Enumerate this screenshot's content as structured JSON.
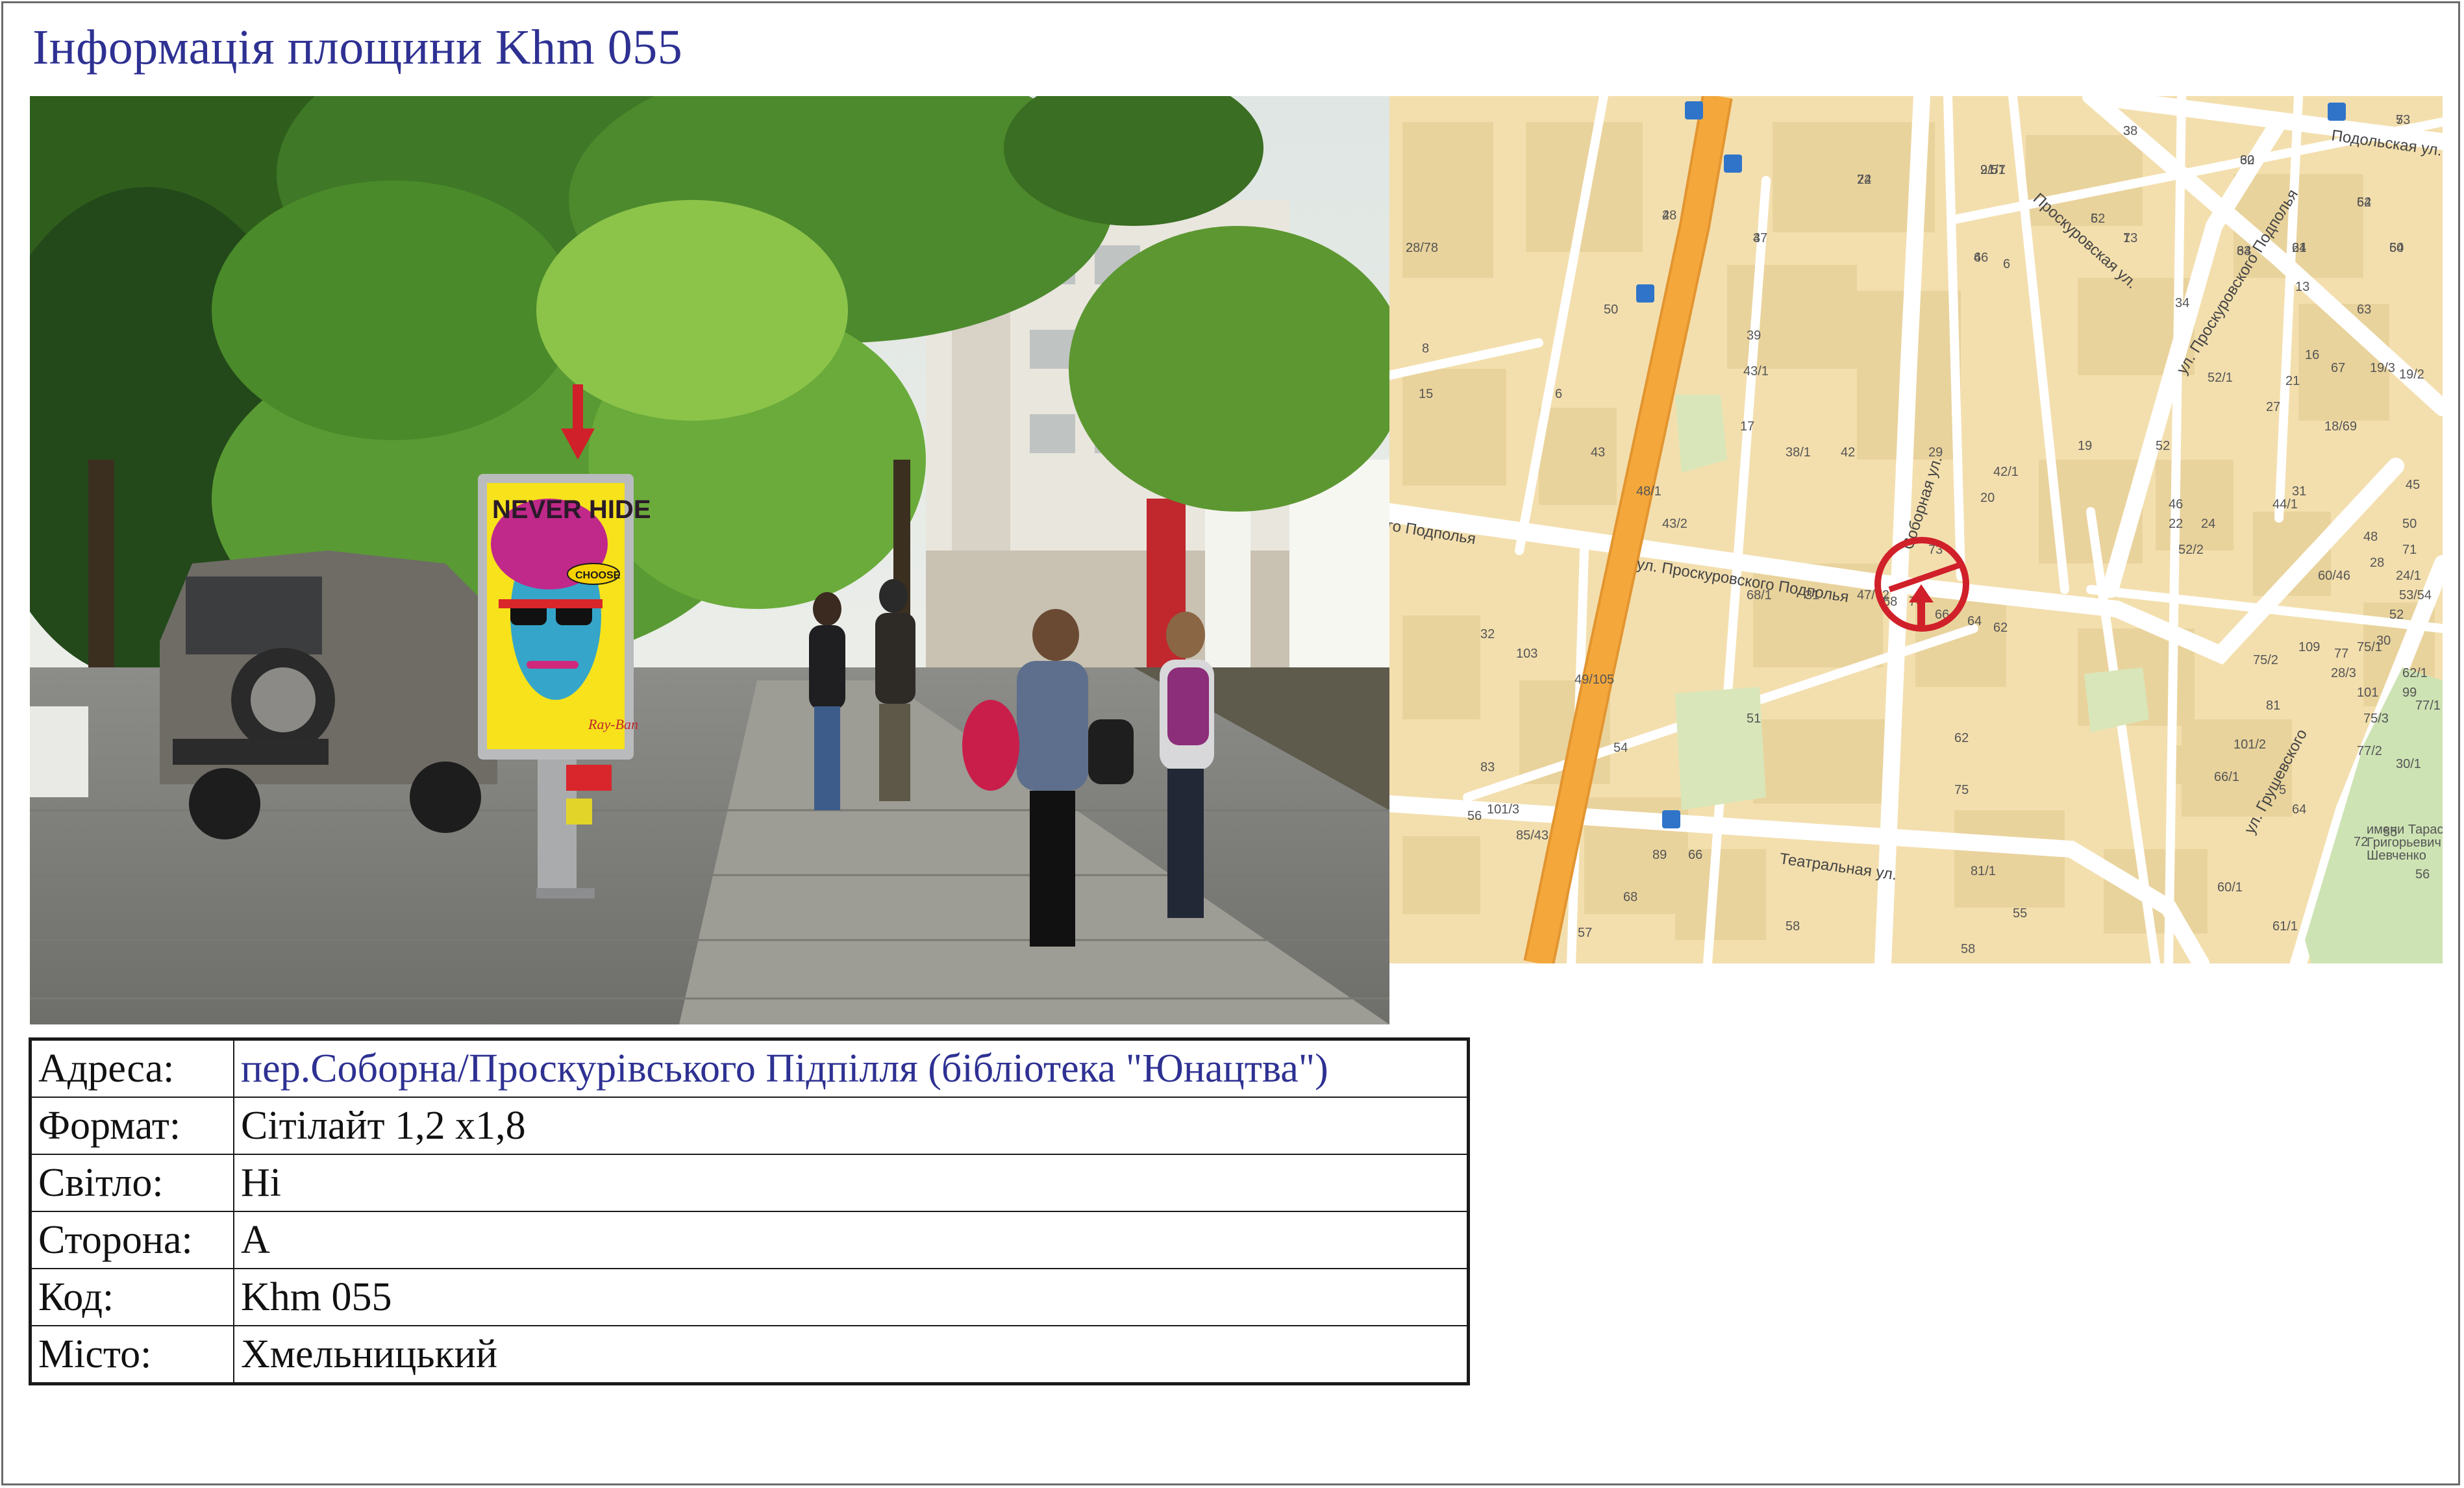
{
  "header": {
    "title": "Інформація площини Khm 055"
  },
  "photo": {
    "poster_text": "NEVER HIDE",
    "poster_badge": "CHOOSE",
    "poster_brand": "Ray-Ban"
  },
  "map": {
    "streets": [
      "ул. Проскуровского Подполья",
      "ского Подполья",
      "Соборная ул.",
      "Проскуровская ул.",
      "ул. Проскуровского Подполья",
      "Подольская ул.",
      "Театральная ул.",
      "ул. Грушевского"
    ],
    "park_label": [
      "имени Тараса",
      "Григорьевич",
      "Шевченко"
    ],
    "house_numbers": [
      "38",
      "73",
      "21/1",
      "32",
      "22",
      "48",
      "37",
      "5",
      "7",
      "34",
      "61",
      "52",
      "54",
      "2",
      "4",
      "6",
      "13",
      "50",
      "34",
      "63",
      "16",
      "39",
      "8",
      "43/1",
      "67",
      "19/3",
      "19/2",
      "21",
      "15",
      "6",
      "52/1",
      "27",
      "18/69",
      "17",
      "19",
      "43",
      "29",
      "52",
      "42",
      "38/1",
      "42/1",
      "48/1",
      "46",
      "31",
      "45",
      "43/2",
      "20",
      "22",
      "24",
      "52/2",
      "44/1",
      "50",
      "48",
      "71",
      "73",
      "28",
      "24/1",
      "68/1",
      "31",
      "47/72",
      "68",
      "70",
      "66",
      "64",
      "62",
      "60/46",
      "53/54",
      "52",
      "75",
      "30",
      "32",
      "109",
      "77",
      "75/1",
      "75/2",
      "28/3",
      "62/1",
      "103",
      "101",
      "99",
      "49/105",
      "81",
      "77/1",
      "75/3",
      "51",
      "62",
      "101/2",
      "77/2",
      "30/1",
      "5",
      "54",
      "83",
      "66/1",
      "64",
      "101/3",
      "56",
      "85/43",
      "81/1",
      "55",
      "66",
      "89",
      "72",
      "68",
      "57",
      "56",
      "60/1",
      "55",
      "61/1",
      "58",
      "58",
      "3",
      "5",
      "9/57",
      "60",
      "74",
      "2",
      "4",
      "62",
      "13",
      "63",
      "24",
      "64",
      "60",
      "28/78",
      "66"
    ]
  },
  "info": {
    "rows": [
      {
        "key": "Адреса:",
        "value": "пер.Соборна/Проскурівського Підпілля  (бібліотека \"Юнацтва\")"
      },
      {
        "key": "Формат:",
        "value": "Сітілайт 1,2 х1,8"
      },
      {
        "key": "Світло:",
        "value": "Ні"
      },
      {
        "key": "Сторона:",
        "value": " А"
      },
      {
        "key": "Код:",
        "value": "Khm 055"
      },
      {
        "key": "Місто:",
        "value": " Хмельницький"
      }
    ]
  },
  "colors": {
    "title": "#2e3192",
    "map_bg": "#f3dfae",
    "major_road": "#f4a83c",
    "marker": "#d0202a",
    "park": "#cde3b4"
  }
}
